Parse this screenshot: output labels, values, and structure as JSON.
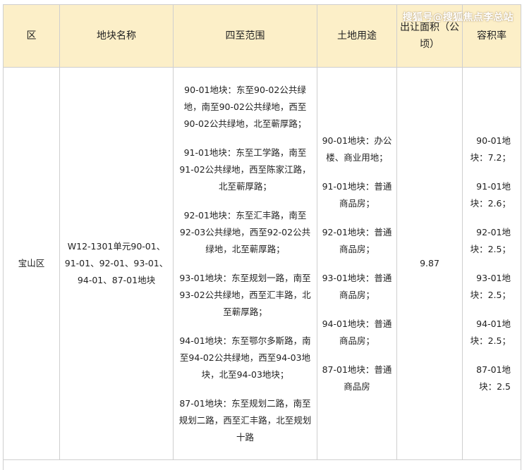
{
  "watermark": "搜狐号@搜狐焦点李总站",
  "headers": {
    "district": "区",
    "plot_name": "地块名称",
    "boundaries": "四至范围",
    "land_use": "土地用途",
    "area": "出让面积（公顷）",
    "far": "容积率"
  },
  "row": {
    "district": "宝山区",
    "plot_name": "W12-1301单元90-01、91-01、92-01、93-01、94-01、87-01地块",
    "boundaries": [
      "90-01地块：东至90-02公共绿地，南至90-02公共绿地，西至90-02公共绿地，北至蕲厚路；",
      "91-01地块：东至工学路，南至91-02公共绿地，西至陈家江路，北至蕲厚路；",
      "92-01地块：东至汇丰路，南至92-03公共绿地，西至92-02公共绿地，北至蕲厚路；",
      "93-01地块：东至规划一路，南至93-02公共绿地，西至汇丰路，北至蕲厚路；",
      "94-01地块：东至鄂尔多斯路，南至94-02公共绿地，西至94-03地块，北至94-03地块；",
      "87-01地块：东至规划二路，南至规划二路，西至汇丰路，北至规划十路"
    ],
    "land_use": [
      "90-01地块：办公楼、商业用地；",
      "91-01地块：普通商品房；",
      "92-01地块：普通商品房；",
      "93-01地块：普通商品房；",
      "94-01地块：普通商品房；",
      "87-01地块：普通商品房"
    ],
    "area": "9.87",
    "far": [
      "90-01地块：7.2；",
      "91-01地块：2.6；",
      "92-01地块：2.5；",
      "93-01地块：2.5；",
      "94-01地块：2.5；",
      "87-01地块：2.5"
    ]
  }
}
